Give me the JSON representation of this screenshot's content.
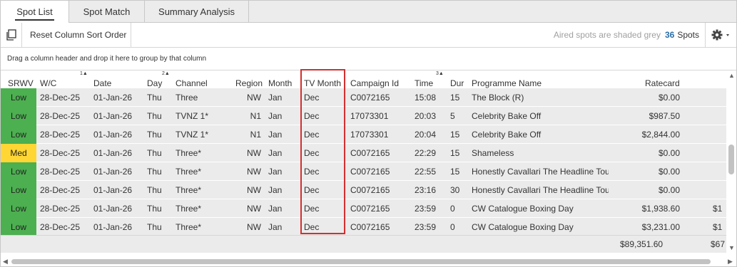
{
  "tabs": [
    {
      "label": "Spot List",
      "active": true
    },
    {
      "label": "Spot Match",
      "active": false
    },
    {
      "label": "Summary Analysis",
      "active": false
    }
  ],
  "toolbar": {
    "reset_label": "Reset Column Sort Order",
    "aired_hint": "Aired spots are shaded grey",
    "spot_count": "36",
    "spots_label": "Spots"
  },
  "group_hint": "Drag a column header and drop it here to group by that column",
  "columns": {
    "srwv": "SRWV",
    "wc": "W/C",
    "date": "Date",
    "day": "Day",
    "channel": "Channel",
    "region": "Region",
    "month": "Month",
    "tv_month": "TV Month",
    "campaign": "Campaign Id",
    "time": "Time",
    "dur": "Dur",
    "programme": "Programme Name",
    "ratecard": "Ratecard"
  },
  "sort_marks": {
    "wc": "1",
    "day": "2",
    "time": "3"
  },
  "rows": [
    {
      "srwv": "Low",
      "level": "low",
      "wc": "28-Dec-25",
      "date": "01-Jan-26",
      "day": "Thu",
      "channel": "Three",
      "region": "NW",
      "month": "Jan",
      "tv_month": "Dec",
      "campaign": "C0072165",
      "time": "15:08",
      "dur": "15",
      "programme": "The Block (R)",
      "ratecard": "$0.00",
      "extra": ""
    },
    {
      "srwv": "Low",
      "level": "low",
      "wc": "28-Dec-25",
      "date": "01-Jan-26",
      "day": "Thu",
      "channel": "TVNZ 1*",
      "region": "N1",
      "month": "Jan",
      "tv_month": "Dec",
      "campaign": "17073301",
      "time": "20:03",
      "dur": "5",
      "programme": "Celebrity Bake Off",
      "ratecard": "$987.50",
      "extra": ""
    },
    {
      "srwv": "Low",
      "level": "low",
      "wc": "28-Dec-25",
      "date": "01-Jan-26",
      "day": "Thu",
      "channel": "TVNZ 1*",
      "region": "N1",
      "month": "Jan",
      "tv_month": "Dec",
      "campaign": "17073301",
      "time": "20:04",
      "dur": "15",
      "programme": "Celebrity Bake Off",
      "ratecard": "$2,844.00",
      "extra": ""
    },
    {
      "srwv": "Med",
      "level": "med",
      "wc": "28-Dec-25",
      "date": "01-Jan-26",
      "day": "Thu",
      "channel": "Three*",
      "region": "NW",
      "month": "Jan",
      "tv_month": "Dec",
      "campaign": "C0072165",
      "time": "22:29",
      "dur": "15",
      "programme": "Shameless",
      "ratecard": "$0.00",
      "extra": ""
    },
    {
      "srwv": "Low",
      "level": "low",
      "wc": "28-Dec-25",
      "date": "01-Jan-26",
      "day": "Thu",
      "channel": "Three*",
      "region": "NW",
      "month": "Jan",
      "tv_month": "Dec",
      "campaign": "C0072165",
      "time": "22:55",
      "dur": "15",
      "programme": "Honestly Cavallari The Headline Tou",
      "ratecard": "$0.00",
      "extra": ""
    },
    {
      "srwv": "Low",
      "level": "low",
      "wc": "28-Dec-25",
      "date": "01-Jan-26",
      "day": "Thu",
      "channel": "Three*",
      "region": "NW",
      "month": "Jan",
      "tv_month": "Dec",
      "campaign": "C0072165",
      "time": "23:16",
      "dur": "30",
      "programme": "Honestly Cavallari The Headline Tou",
      "ratecard": "$0.00",
      "extra": ""
    },
    {
      "srwv": "Low",
      "level": "low",
      "wc": "28-Dec-25",
      "date": "01-Jan-26",
      "day": "Thu",
      "channel": "Three*",
      "region": "NW",
      "month": "Jan",
      "tv_month": "Dec",
      "campaign": "C0072165",
      "time": "23:59",
      "dur": "0",
      "programme": "CW Catalogue Boxing Day",
      "ratecard": "$1,938.60",
      "extra": "$1"
    },
    {
      "srwv": "Low",
      "level": "low",
      "wc": "28-Dec-25",
      "date": "01-Jan-26",
      "day": "Thu",
      "channel": "Three*",
      "region": "NW",
      "month": "Jan",
      "tv_month": "Dec",
      "campaign": "C0072165",
      "time": "23:59",
      "dur": "0",
      "programme": "CW Catalogue Boxing Day",
      "ratecard": "$3,231.00",
      "extra": "$1"
    }
  ],
  "footer": {
    "ratecard_total": "$89,351.60",
    "extra_total": "$67"
  },
  "colors": {
    "low": "#4caf50",
    "med": "#ffd633",
    "highlight": "#d32f2f",
    "count": "#2a6ea8"
  }
}
